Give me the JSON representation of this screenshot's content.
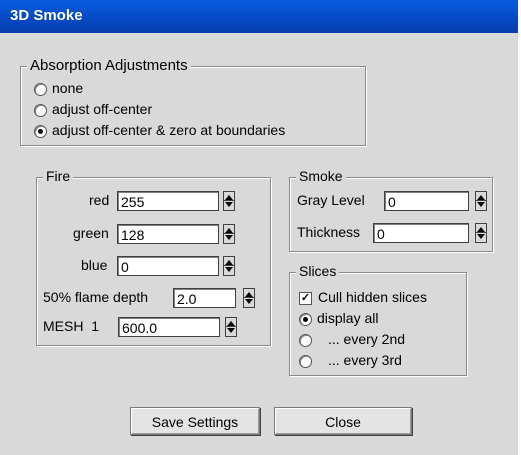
{
  "window": {
    "title": "3D Smoke"
  },
  "absorption": {
    "legend": "Absorption Adjustments",
    "options": [
      {
        "label": "none",
        "selected": false
      },
      {
        "label": "adjust off-center",
        "selected": false
      },
      {
        "label": "adjust off-center & zero at boundaries",
        "selected": true
      }
    ]
  },
  "fire": {
    "legend": "Fire",
    "red": {
      "label": "red",
      "value": "255"
    },
    "green": {
      "label": "green",
      "value": "128"
    },
    "blue": {
      "label": "blue",
      "value": "0"
    },
    "flame_depth": {
      "label": "50% flame depth",
      "value": "2.0"
    },
    "mesh": {
      "label": "MESH  1",
      "value": "600.0"
    }
  },
  "smoke": {
    "legend": "Smoke",
    "gray_level": {
      "label": "Gray Level",
      "value": "0"
    },
    "thickness": {
      "label": "Thickness",
      "value": "0"
    }
  },
  "slices": {
    "legend": "Slices",
    "cull_hidden": {
      "label": "Cull hidden slices",
      "checked": true
    },
    "options": [
      {
        "label": "display all",
        "selected": true
      },
      {
        "label": "... every 2nd",
        "selected": false
      },
      {
        "label": "... every 3rd",
        "selected": false
      }
    ]
  },
  "buttons": {
    "save": "Save Settings",
    "close": "Close"
  }
}
